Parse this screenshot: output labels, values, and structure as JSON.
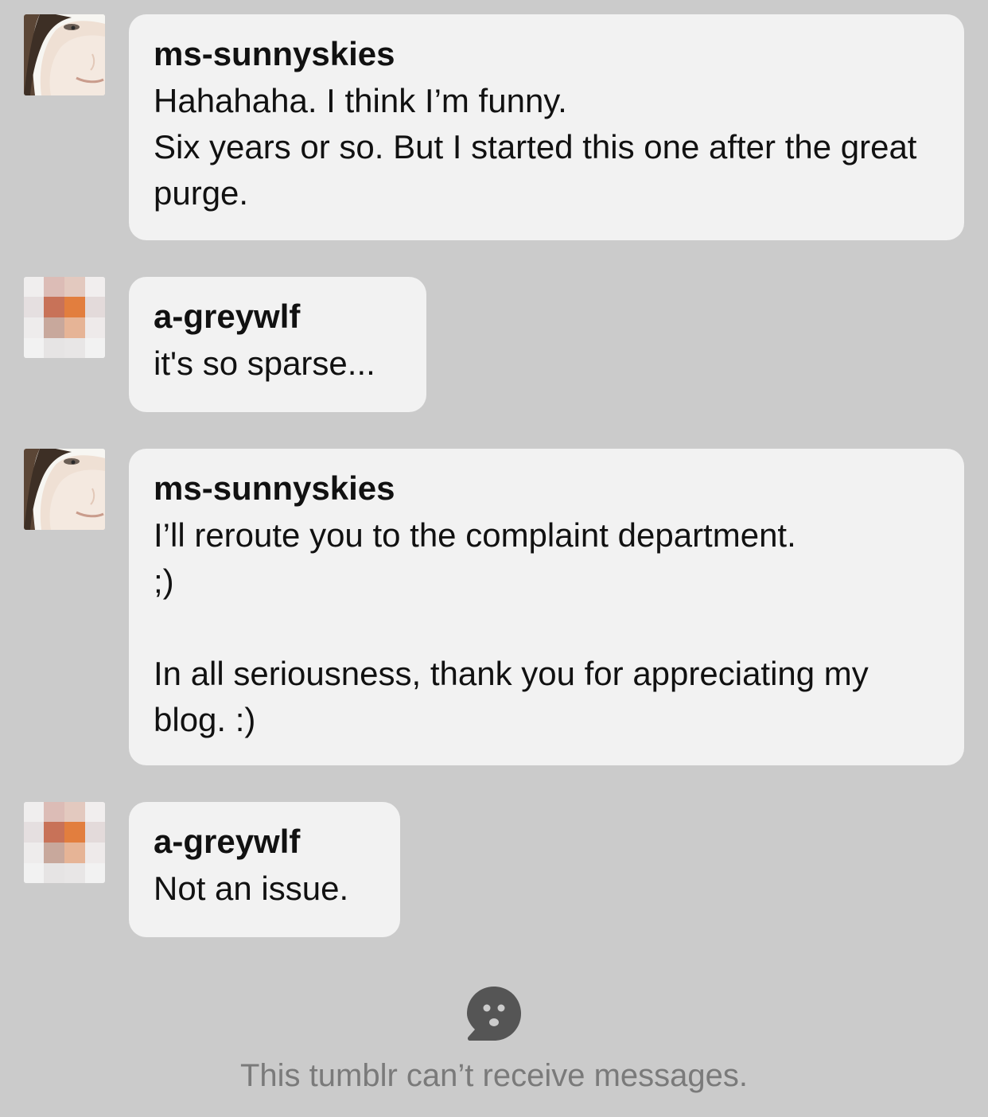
{
  "messages": [
    {
      "sender": "ms-sunnyskies",
      "avatar": "face-photo-avatar",
      "text": "Hahahaha. I think I’m funny.\nSix years or so. But I started this one after the great purge."
    },
    {
      "sender": "a-greywlf",
      "avatar": "pixelated-avatar",
      "text": "it's so sparse..."
    },
    {
      "sender": "ms-sunnyskies",
      "avatar": "face-photo-avatar",
      "text": "I’ll reroute you to the complaint department.\n;)\n\nIn all seriousness, thank you for appreciating my blog. :)"
    },
    {
      "sender": "a-greywlf",
      "avatar": "pixelated-avatar",
      "text": "Not an issue."
    }
  ],
  "notice": {
    "icon": "sad-chat-bubble-icon",
    "text": "This tumblr can’t receive messages."
  },
  "colors": {
    "background": "#cbcbcb",
    "bubble": "#f2f2f2",
    "text": "#111111",
    "muted_text": "#7a7a7a",
    "icon": "#555555"
  }
}
